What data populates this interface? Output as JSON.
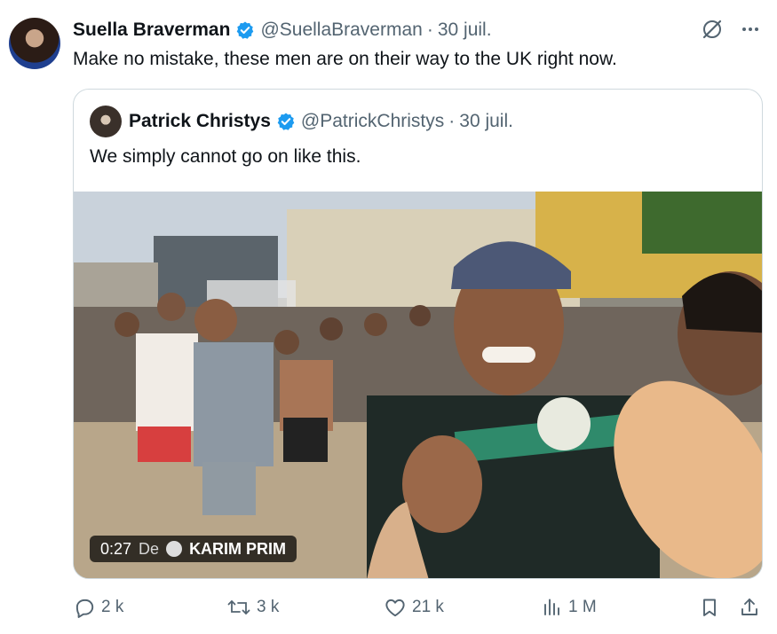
{
  "post": {
    "author_name": "Suella Braverman",
    "author_handle": "@SuellaBraverman",
    "separator": "·",
    "date": "30 juil.",
    "text": "Make no mistake, these men are on their way to the UK right now."
  },
  "quoted": {
    "author_name": "Patrick Christys",
    "author_handle": "@PatrickChristys",
    "separator": "·",
    "date": "30 juil.",
    "text": "We simply cannot go on like this.",
    "video": {
      "duration": "0:27",
      "from_label": "De",
      "source_user": "KARIM PRIM"
    }
  },
  "actions": {
    "replies": "2 k",
    "reposts": "3 k",
    "likes": "21 k",
    "views": "1 M"
  },
  "icons": [
    "verified-badge-icon",
    "grok-icon",
    "more-icon",
    "reply-icon",
    "repost-icon",
    "like-icon",
    "views-icon",
    "bookmark-icon",
    "share-icon"
  ],
  "colors": {
    "verified_blue": "#1d9bf0",
    "text": "#0f1419",
    "muted": "#536471",
    "border": "#cfd9de"
  }
}
